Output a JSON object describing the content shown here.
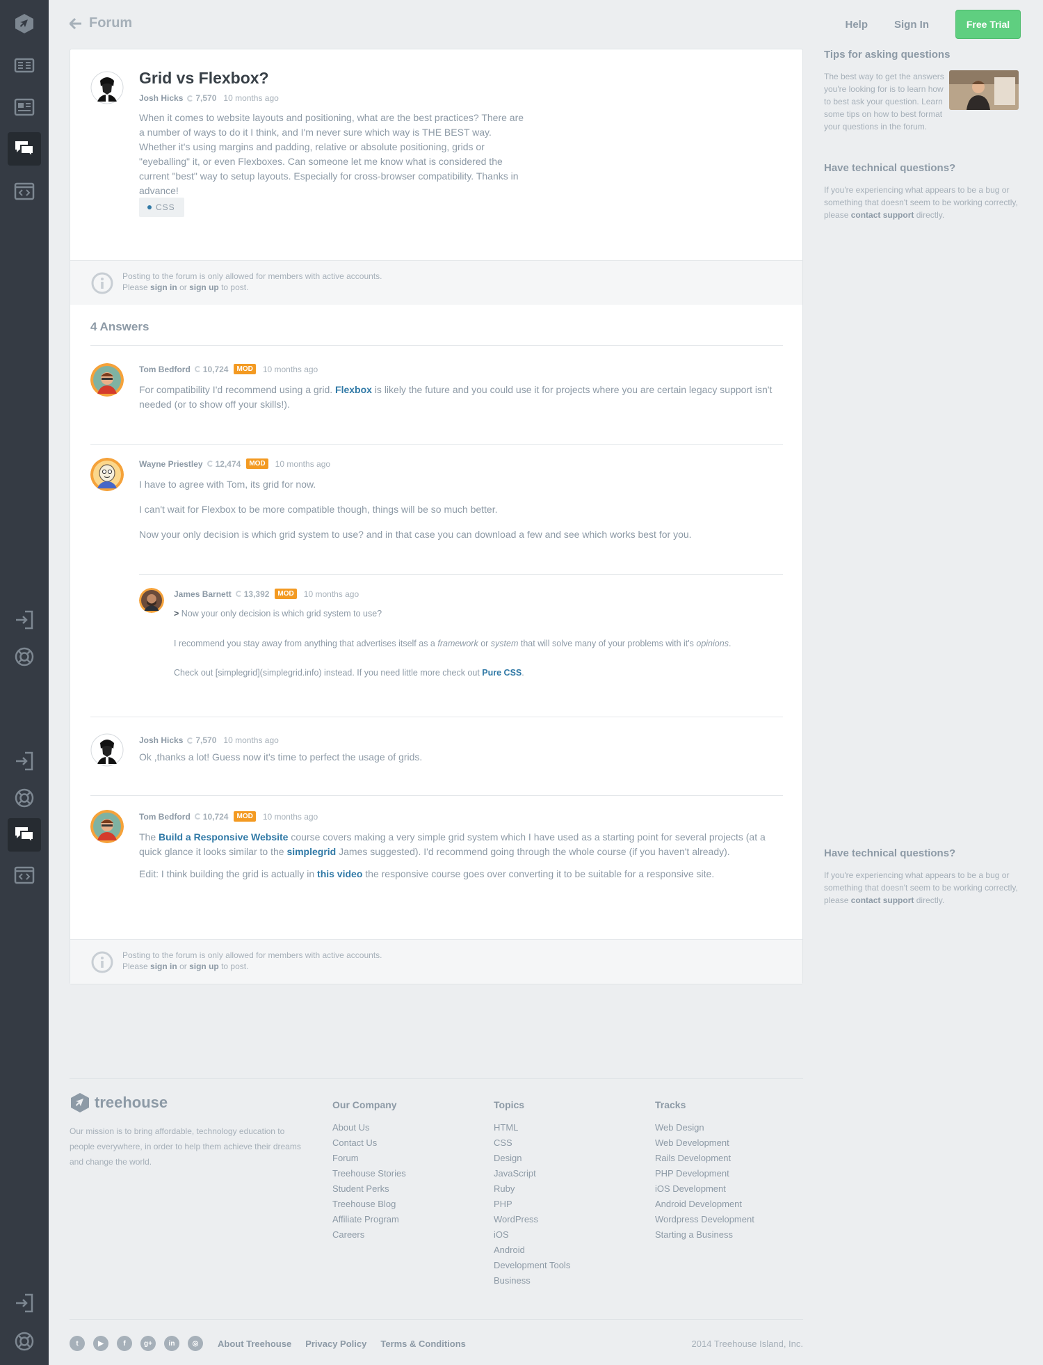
{
  "sidebar": {
    "items": [
      {
        "name": "treehouse-logo-icon"
      },
      {
        "name": "library-icon"
      },
      {
        "name": "news-icon"
      },
      {
        "name": "forum-icon",
        "active": true
      },
      {
        "name": "code-workspace-icon"
      },
      {
        "name": "sign-in-icon"
      },
      {
        "name": "support-icon"
      },
      {
        "name": "sign-in-icon"
      },
      {
        "name": "support-icon"
      },
      {
        "name": "forum-icon",
        "active": true
      },
      {
        "name": "code-workspace-icon"
      },
      {
        "name": "sign-in-icon"
      },
      {
        "name": "support-icon"
      }
    ]
  },
  "header": {
    "back_label": "Forum",
    "help": "Help",
    "sign_in": "Sign In",
    "free_trial": "Free Trial"
  },
  "question": {
    "title": "Grid vs Flexbox?",
    "author": "Josh Hicks",
    "points": "7,570",
    "time": "10 months ago",
    "body": "When it comes to website layouts and positioning, what are the best practices? There are a number of ways to do it I think, and I'm never sure which way is THE BEST way. Whether it's using margins and padding, relative or absolute positioning, grids or \"eyeballing\" it, or even Flexboxes. Can someone let me know what is considered the current \"best\" way to setup layouts. Especially for cross-browser compatibility. Thanks in advance!",
    "tag": "CSS"
  },
  "notice": {
    "line1": "Posting to the forum is only allowed for members with active accounts.",
    "please": "Please",
    "sign_in": "sign in",
    "or": "or",
    "sign_up": "sign up",
    "to_post": "to post."
  },
  "answers_heading": "4 Answers",
  "answers": [
    {
      "author": "Tom Bedford",
      "points": "10,724",
      "badge": "MOD",
      "time": "10 months ago",
      "p1_a": "For compatibility I'd recommend using a grid.",
      "p1_link": "Flexbox",
      "p1_b": "is likely the future and you could use it for projects where you are certain legacy support isn't needed (or to show off your skills!)."
    },
    {
      "author": "Wayne Priestley",
      "points": "12,474",
      "badge": "MOD",
      "time": "10 months ago",
      "p1": "I have to agree with Tom, its grid for now.",
      "p2": "I can't wait for Flexbox to be more compatible though, things will be so much better.",
      "p3": "Now your only decision is which grid system to use? and in that case you can download a few and see which works best for you."
    },
    {
      "author": "James Barnett",
      "points": "13,392",
      "badge": "MOD",
      "time": "10 months ago",
      "quote_mark": ">",
      "quote": "Now your only decision is which grid system to use?",
      "p2_a": "I recommend you stay away from anything that advertises itself as a",
      "p2_em1": "framework",
      "p2_or": "or",
      "p2_em2": "system",
      "p2_b": "that will solve many of your problems with it's",
      "p2_em3": "opinions",
      "p2_end": ".",
      "p3_a": "Check out [simplegrid](simplegrid.info) instead. If you need little more check out",
      "p3_link": "Pure CSS",
      "p3_end": "."
    },
    {
      "author": "Josh Hicks",
      "points": "7,570",
      "time": "10 months ago",
      "p1": "Ok ,thanks a lot! Guess now it's time to perfect the usage of grids."
    },
    {
      "author": "Tom Bedford",
      "points": "10,724",
      "badge": "MOD",
      "time": "10 months ago",
      "p1_a": "The",
      "p1_link1": "Build a Responsive Website",
      "p1_b": "course covers making a very simple grid system which I have used as a starting point for several projects (at a quick glance it looks similar to the",
      "p1_link2": "simplegrid",
      "p1_c": "James suggested). I'd recommend going through the whole course (if you haven't already).",
      "p2_a": "Edit: I think building the grid is actually in",
      "p2_link": "this video",
      "p2_b": "the responsive course goes over converting it to be suitable for a responsive site."
    }
  ],
  "right": {
    "tips_heading": "Tips for asking questions",
    "tips_text": "The best way to get the answers you're looking for is to learn how to best ask your question. Learn some tips on how to best format your questions in the forum.",
    "tech_heading": "Have technical questions?",
    "tech_text_a": "If you're experiencing what appears to be a bug or something that doesn't seem to be working correctly, please",
    "tech_link": "contact support",
    "tech_text_b": "directly."
  },
  "footer": {
    "logo": "treehouse",
    "mission": "Our mission is to bring affordable, technology education to people everywhere, in order to help them achieve their dreams and change the world.",
    "columns": [
      {
        "heading": "Our Company",
        "items": [
          "About Us",
          "Contact Us",
          "Forum",
          "Treehouse Stories",
          "Student Perks",
          "Treehouse Blog",
          "Affiliate Program",
          "Careers"
        ]
      },
      {
        "heading": "Topics",
        "items": [
          "HTML",
          "CSS",
          "Design",
          "JavaScript",
          "Ruby",
          "PHP",
          "WordPress",
          "iOS",
          "Android",
          "Development Tools",
          "Business"
        ]
      },
      {
        "heading": "Tracks",
        "items": [
          "Web Design",
          "Web Development",
          "Rails Development",
          "PHP Development",
          "iOS Development",
          "Android Development",
          "Wordpress Development",
          "Starting a Business"
        ]
      }
    ],
    "social": [
      {
        "name": "twitter-icon",
        "glyph": "t"
      },
      {
        "name": "youtube-icon",
        "glyph": "▶"
      },
      {
        "name": "facebook-icon",
        "glyph": "f"
      },
      {
        "name": "google-plus-icon",
        "glyph": "g+"
      },
      {
        "name": "linkedin-icon",
        "glyph": "in"
      },
      {
        "name": "instagram-icon",
        "glyph": "◎"
      }
    ],
    "links": [
      "About Treehouse",
      "Privacy Policy",
      "Terms & Conditions"
    ],
    "copyright": "2014 Treehouse Island, Inc."
  },
  "colors": {
    "sidebar": "#353b44",
    "accent_green": "#5fcf80",
    "link_blue": "#3079a6",
    "mod_badge": "#f39a22",
    "page_bg": "#eceef0"
  }
}
